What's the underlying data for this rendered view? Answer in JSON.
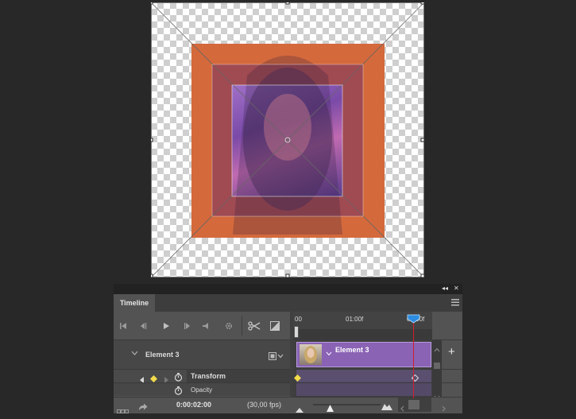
{
  "panel": {
    "tab_label": "Timeline",
    "collapse_glyph": "◂◂",
    "close_glyph": "✕"
  },
  "ruler": {
    "ticks": [
      "00",
      "01:00f",
      "02:00f"
    ]
  },
  "layer": {
    "name": "Element 3",
    "clip_name": "Element 3"
  },
  "properties": {
    "transform_label": "Transform",
    "opacity_label": "Opacity"
  },
  "status": {
    "current_time": "0:00:02:00",
    "fps": "(30,00 fps)"
  },
  "controls": {
    "add_glyph": "+"
  },
  "colors": {
    "playhead": "#d0202c",
    "clip": "#8a63b5",
    "keyframe": "#f3dc4b",
    "canvas_orange": "#d4693c"
  }
}
